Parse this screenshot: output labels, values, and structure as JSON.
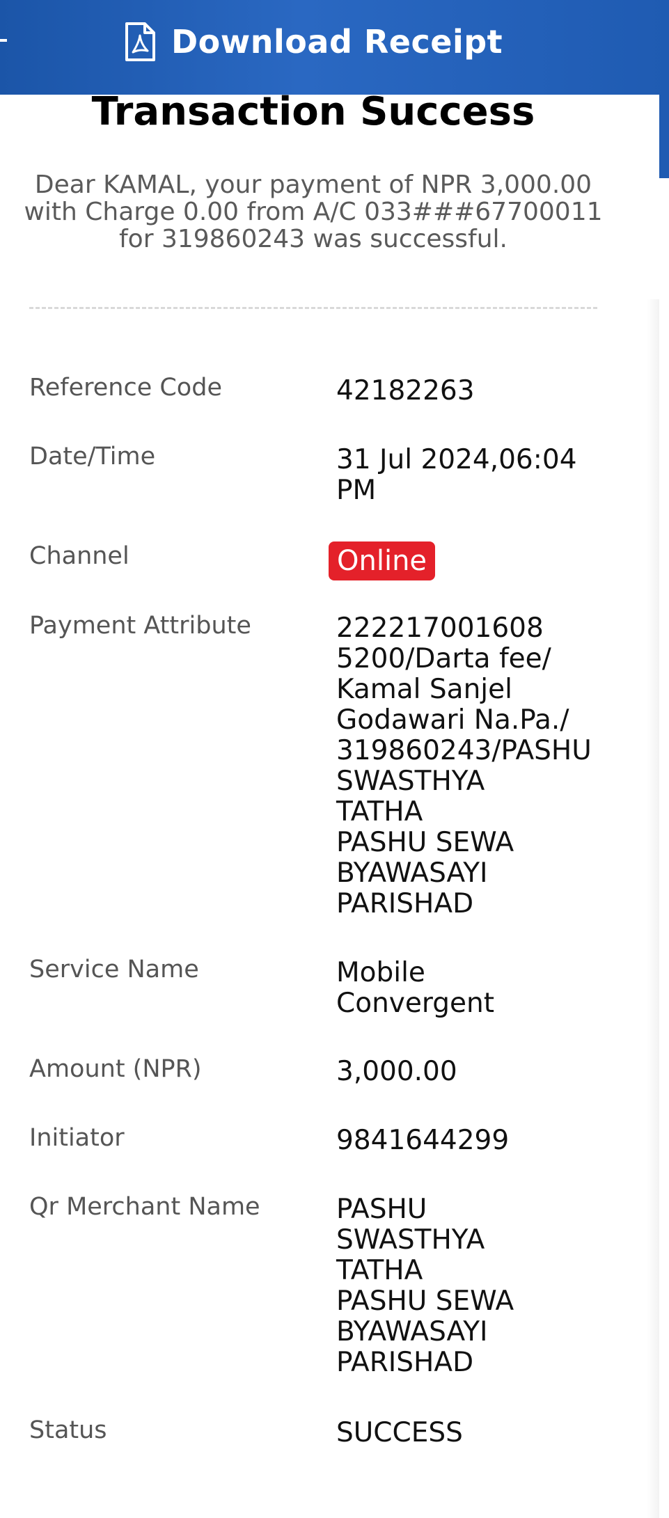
{
  "header": {
    "download_label": "Download Receipt",
    "icon": "pdf-file-icon",
    "background_color": "#1f5bb2"
  },
  "receipt": {
    "title": "Transaction Success",
    "message": "Dear KAMAL, your payment of NPR 3,000.00 with Charge 0.00 from A/C 033###67700011 for 319860243 was successful.",
    "fields": {
      "reference_code": {
        "label": "Reference Code",
        "value": "42182263"
      },
      "date_time": {
        "label": "Date/Time",
        "value": "31 Jul 2024,06:04\nPM"
      },
      "channel": {
        "label": "Channel",
        "value": "Online",
        "badge_color": "#e4212a"
      },
      "payment_attribute": {
        "label": "Payment Attribute",
        "value": "222217001608\n5200/Darta fee/\nKamal Sanjel\nGodawari Na.Pa./\n319860243/PASHU\nSWASTHYA\nTATHA\nPASHU SEWA\nBYAWASAYI\nPARISHAD"
      },
      "service_name": {
        "label": "Service Name",
        "value": "Mobile\nConvergent"
      },
      "amount": {
        "label": "Amount (NPR)",
        "value": "3,000.00"
      },
      "initiator": {
        "label": "Initiator",
        "value": "9841644299"
      },
      "qr_merchant_name": {
        "label": "Qr Merchant Name",
        "value": "PASHU\nSWASTHYA\nTATHA\nPASHU SEWA\nBYAWASAYI\nPARISHAD"
      },
      "status": {
        "label": "Status",
        "value": "SUCCESS"
      }
    }
  }
}
